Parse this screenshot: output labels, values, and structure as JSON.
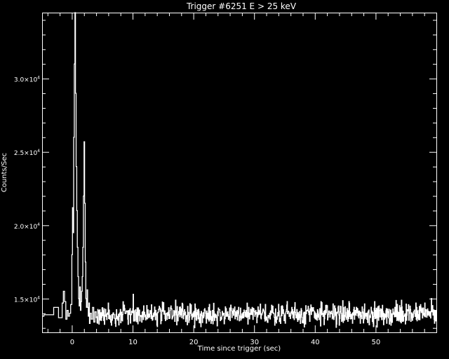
{
  "chart_data": {
    "type": "line",
    "title": "Trigger #6251  E > 25 keV",
    "xlabel": "Time since trigger (sec)",
    "ylabel": "Counts/Sec",
    "xlim": [
      -4.9,
      60
    ],
    "ylim": [
      12700,
      34500
    ],
    "xticks": [
      0,
      10,
      20,
      30,
      40,
      50
    ],
    "xtick_labels": [
      "0",
      "10",
      "20",
      "30",
      "40",
      "50"
    ],
    "yticks": [
      15000,
      20000,
      25000,
      30000
    ],
    "ytick_labels": [
      {
        "mantissa": "1.5",
        "exponent": "4"
      },
      {
        "mantissa": "2.0",
        "exponent": "4"
      },
      {
        "mantissa": "2.5",
        "exponent": "4"
      },
      {
        "mantissa": "3.0",
        "exponent": "4"
      }
    ],
    "times_label": "×10",
    "grid": false,
    "colors": {
      "background": "#000000",
      "foreground": "#ffffff"
    },
    "series": [
      {
        "step": 0.064,
        "x": [
          -4.9,
          -4.6,
          -3.0,
          -3.0,
          -2.2,
          -2.2,
          -1.6,
          -1.4,
          -1.2,
          -1.0,
          -0.8,
          -0.6,
          -0.4,
          -0.2,
          0.0,
          0.1,
          0.2,
          0.3,
          0.4,
          0.5,
          0.6,
          0.7,
          0.8,
          0.9,
          1.0,
          1.1,
          1.2,
          1.3,
          1.4,
          1.5,
          1.6,
          1.7,
          1.8,
          1.9,
          2.0,
          2.1,
          2.2,
          2.3,
          2.4,
          2.5,
          2.6,
          2.7,
          2.8,
          2.9,
          3.0,
          3.2,
          3.4,
          3.6,
          3.8,
          4.0
        ],
        "y": [
          13800,
          13900,
          13900,
          14400,
          14400,
          13700,
          14700,
          15500,
          14800,
          13600,
          14200,
          13800,
          14000,
          14600,
          18000,
          21200,
          19500,
          26000,
          31000,
          34500,
          29000,
          24000,
          21000,
          18500,
          16500,
          15000,
          14500,
          15800,
          14200,
          14800,
          15500,
          16500,
          18500,
          22000,
          25700,
          21500,
          17500,
          15000,
          14400,
          15600,
          14400,
          13800,
          14700,
          13300,
          14000,
          13600,
          14400,
          13400,
          14100,
          13700
        ]
      }
    ]
  }
}
